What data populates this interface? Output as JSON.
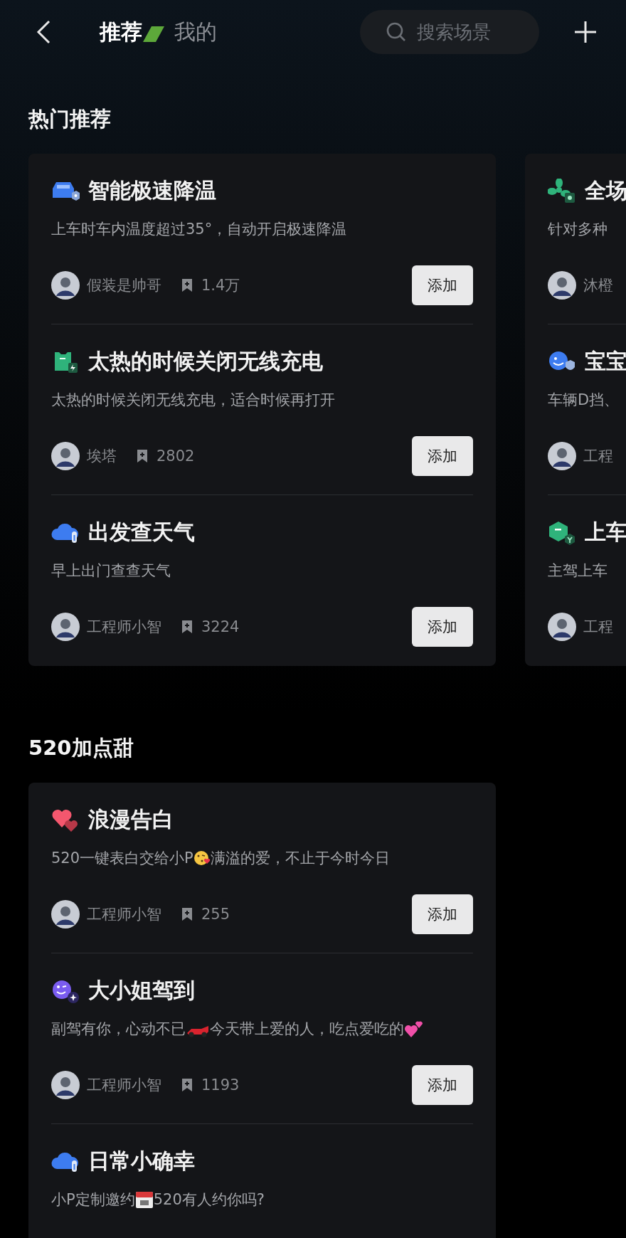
{
  "header": {
    "tabs": [
      {
        "label": "推荐",
        "selected": true
      },
      {
        "label": "我的",
        "selected": false
      }
    ],
    "search": {
      "placeholder": "搜索场景"
    }
  },
  "sections": [
    {
      "title": "热门推荐",
      "cards": [
        {
          "items": [
            {
              "kind": "car",
              "title": "智能极速降温",
              "description": [
                {
                  "kind": "text",
                  "text": "上车时车内温度超过35°，自动开启极速降温"
                }
              ],
              "author": "假装是帅哥",
              "saves": "1.4万",
              "button": "添加"
            },
            {
              "kind": "charger",
              "title": "太热的时候关闭无线充电",
              "description": [
                {
                  "kind": "text",
                  "text": "太热的时候关闭无线充电，适合时候再打开"
                }
              ],
              "author": "埃塔",
              "saves": "2802",
              "button": "添加"
            },
            {
              "kind": "cloud",
              "title": "出发查天气",
              "description": [
                {
                  "kind": "text",
                  "text": "早上出门查查天气"
                }
              ],
              "author": "工程师小智",
              "saves": "3224",
              "button": "添加"
            }
          ]
        },
        {
          "items": [
            {
              "kind": "fan",
              "title": "全场",
              "description": [
                {
                  "kind": "text",
                  "text": "针对多种"
                }
              ],
              "author": "沐橙"
            },
            {
              "kind": "face",
              "title": "宝宝",
              "description": [
                {
                  "kind": "text",
                  "text": "车辆D挡、"
                }
              ],
              "author": "工程"
            },
            {
              "kind": "hexagon",
              "title": "上车",
              "description": [
                {
                  "kind": "text",
                  "text": "主驾上车"
                }
              ],
              "author": "工程"
            }
          ]
        }
      ]
    },
    {
      "title": "520加点甜",
      "cards": [
        {
          "items": [
            {
              "kind": "heart",
              "title": "浪漫告白",
              "description": [
                {
                  "kind": "text",
                  "text": "520一键表白交给小P"
                },
                {
                  "kind": "kiss"
                },
                {
                  "kind": "text",
                  "text": "满溢的爱，不止于今时今日"
                }
              ],
              "author": "工程师小智",
              "saves": "255",
              "button": "添加"
            },
            {
              "kind": "wink",
              "title": "大小姐驾到",
              "description": [
                {
                  "kind": "text",
                  "text": "副驾有你，心动不已"
                },
                {
                  "kind": "racecar"
                },
                {
                  "kind": "text",
                  "text": "今天带上爱的人，吃点爱吃的"
                },
                {
                  "kind": "hearts"
                }
              ],
              "author": "工程师小智",
              "saves": "1193",
              "button": "添加"
            },
            {
              "kind": "cloud",
              "title": "日常小确幸",
              "description": [
                {
                  "kind": "text",
                  "text": "小P定制邀约"
                },
                {
                  "kind": "calendar"
                },
                {
                  "kind": "text",
                  "text": "520有人约你吗?"
                }
              ]
            }
          ]
        }
      ]
    }
  ]
}
